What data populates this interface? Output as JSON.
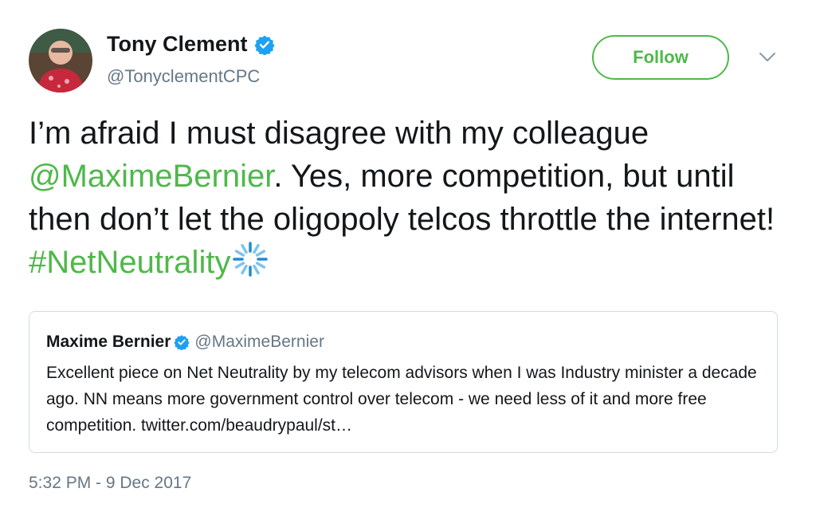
{
  "author": {
    "name": "Tony Clement",
    "handle": "@TonyclementCPC"
  },
  "follow_button": {
    "label": "Follow"
  },
  "tweet": {
    "text_part1": "I’m afraid I must disagree with my colleague ",
    "mention": "@MaximeBernier",
    "text_part2": ". Yes, more competition, but until then don’t let the oligopoly telcos throttle the internet! ",
    "hashtag": "#NetNeutrality"
  },
  "quote": {
    "name": "Maxime Bernier",
    "handle": "@MaximeBernier",
    "text": "Excellent piece on Net Neutrality by my telecom advisors when I was Industry minister a decade ago. NN means more government control over telecom - we need less of it and more free competition. twitter.com/beaudrypaul/st…"
  },
  "timestamp": "5:32 PM - 9 Dec 2017",
  "icons": {
    "verified": "verified-badge-icon",
    "caret": "chevron-down-icon",
    "hashtag_emoji": "loading-spinner-icon"
  },
  "colors": {
    "accent": "#4fb84a",
    "verified": "#1da1f2",
    "muted": "#657786"
  }
}
